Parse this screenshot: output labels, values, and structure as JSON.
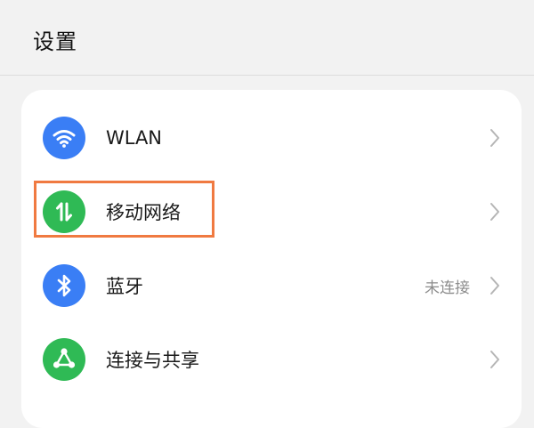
{
  "header": {
    "title": "设置"
  },
  "settings": {
    "items": [
      {
        "label": "WLAN",
        "value": "",
        "icon": "wifi-icon",
        "icon_color": "#3a7ef5"
      },
      {
        "label": "移动网络",
        "value": "",
        "icon": "mobile-data-icon",
        "icon_color": "#2fba55"
      },
      {
        "label": "蓝牙",
        "value": "未连接",
        "icon": "bluetooth-icon",
        "icon_color": "#3a7ef5"
      },
      {
        "label": "连接与共享",
        "value": "",
        "icon": "share-icon",
        "icon_color": "#2fba55"
      }
    ]
  },
  "colors": {
    "highlight": "#f07a41",
    "chevron": "#b5b5b5"
  }
}
